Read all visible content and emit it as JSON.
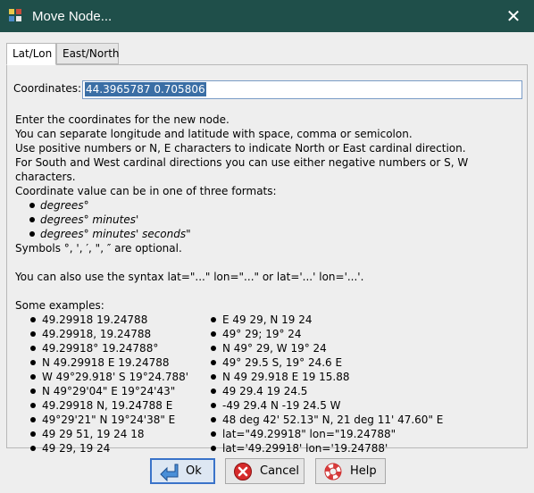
{
  "window": {
    "title": "Move Node...",
    "close_glyph": "✕",
    "icon": "josm-app-icon"
  },
  "tabs": [
    {
      "label": "Lat/Lon",
      "active": true
    },
    {
      "label": "East/North",
      "active": false
    }
  ],
  "coordinates": {
    "label": "Coordinates:",
    "value": "44.3965787 0.705806"
  },
  "help": {
    "lines": [
      "Enter the coordinates for the new node.",
      "You can separate longitude and latitude with space, comma or semicolon.",
      "Use positive numbers or N, E characters to indicate North or East cardinal direction.",
      "For South and West cardinal directions you can use either negative numbers or S, W characters.",
      "Coordinate value can be in one of three formats:"
    ],
    "formats": [
      "degrees°",
      "degrees° minutes'",
      "degrees° minutes' seconds\""
    ],
    "symbols_note": "Symbols °, ', ′, \", ″ are optional.",
    "syntax_note": "You can also use the syntax lat=\"...\" lon=\"...\" or lat='...' lon='...'.",
    "examples_heading": "Some examples:",
    "examples_left": [
      "49.29918 19.24788",
      "49.29918, 19.24788",
      "49.29918° 19.24788°",
      "N 49.29918 E 19.24788",
      "W 49°29.918' S 19°24.788'",
      "N 49°29'04\" E 19°24'43\"",
      "49.29918 N, 19.24788 E",
      "49°29'21\" N 19°24'38\" E",
      "49 29 51, 19 24 18",
      "49 29, 19 24"
    ],
    "examples_right": [
      "E 49 29, N 19 24",
      "49° 29; 19° 24",
      "N 49° 29, W 19° 24",
      "49° 29.5 S, 19° 24.6 E",
      "N 49 29.918 E 19 15.88",
      "49 29.4 19 24.5",
      "-49 29.4 N -19 24.5 W",
      "48 deg 42' 52.13\" N, 21 deg 11' 47.60\" E",
      "lat=\"49.29918\" lon=\"19.24788\"",
      "lat='49.29918' lon='19.24788'"
    ]
  },
  "buttons": {
    "ok": {
      "label": "Ok",
      "icon": "ok-arrow-icon"
    },
    "cancel": {
      "label": "Cancel",
      "icon": "cancel-icon"
    },
    "help": {
      "label": "Help",
      "icon": "help-lifebuoy-icon"
    }
  },
  "colors": {
    "titlebar": "#1f4f4a",
    "selection": "#3a6ea5",
    "primary_border": "#3a73c9"
  }
}
